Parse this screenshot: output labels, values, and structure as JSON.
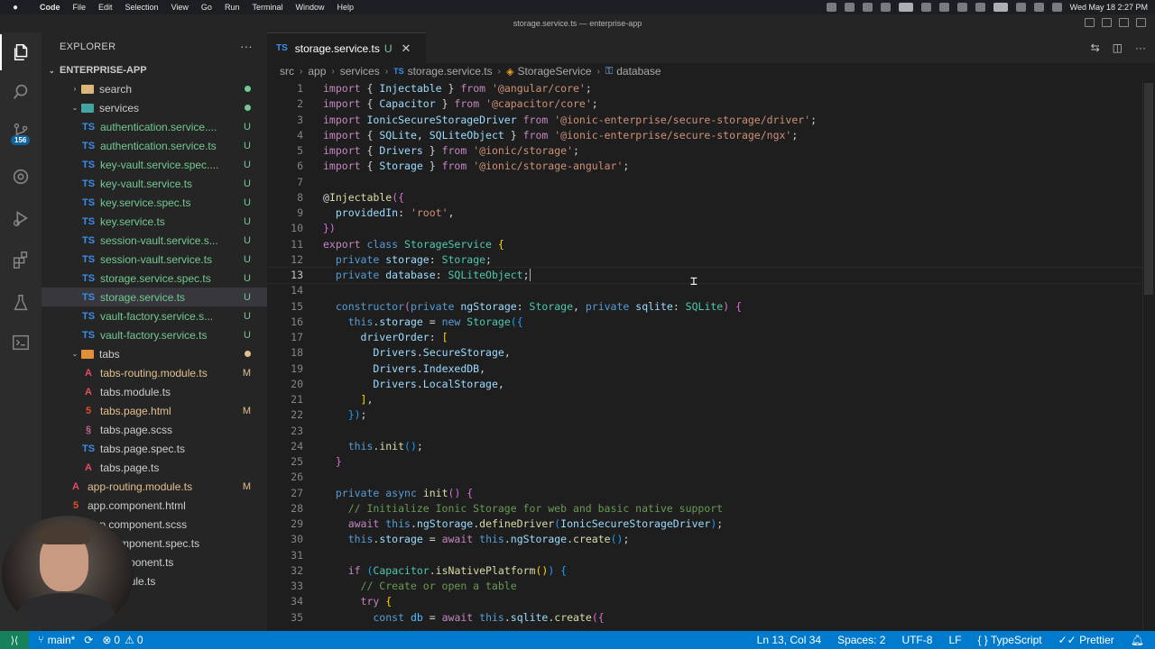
{
  "menubar": {
    "app": "Code",
    "items": [
      "File",
      "Edit",
      "Selection",
      "View",
      "Go",
      "Run",
      "Terminal",
      "Window",
      "Help"
    ],
    "clock": "Wed May 18  2:27 PM"
  },
  "window": {
    "title": "storage.service.ts — enterprise-app"
  },
  "activitybar": {
    "scm_badge": "156"
  },
  "sidebar": {
    "header": "EXPLORER",
    "more": "···",
    "root": "ENTERPRISE-APP",
    "rows": [
      {
        "label": "search",
        "kind": "folder",
        "indent": 1,
        "chev": "›",
        "dot": "#73c991"
      },
      {
        "label": "services",
        "kind": "folder",
        "indent": 1,
        "chev": "⌄",
        "dot": "#73c991"
      },
      {
        "label": "authentication.service....",
        "kind": "ts",
        "indent": 2,
        "status": "U"
      },
      {
        "label": "authentication.service.ts",
        "kind": "ts",
        "indent": 2,
        "status": "U"
      },
      {
        "label": "key-vault.service.spec....",
        "kind": "ts",
        "indent": 2,
        "status": "U"
      },
      {
        "label": "key-vault.service.ts",
        "kind": "ts",
        "indent": 2,
        "status": "U"
      },
      {
        "label": "key.service.spec.ts",
        "kind": "ts",
        "indent": 2,
        "status": "U"
      },
      {
        "label": "key.service.ts",
        "kind": "ts",
        "indent": 2,
        "status": "U"
      },
      {
        "label": "session-vault.service.s...",
        "kind": "ts",
        "indent": 2,
        "status": "U"
      },
      {
        "label": "session-vault.service.ts",
        "kind": "ts",
        "indent": 2,
        "status": "U"
      },
      {
        "label": "storage.service.spec.ts",
        "kind": "ts",
        "indent": 2,
        "status": "U"
      },
      {
        "label": "storage.service.ts",
        "kind": "ts",
        "indent": 2,
        "status": "U",
        "selected": true
      },
      {
        "label": "vault-factory.service.s...",
        "kind": "ts",
        "indent": 2,
        "status": "U"
      },
      {
        "label": "vault-factory.service.ts",
        "kind": "ts",
        "indent": 2,
        "status": "U"
      },
      {
        "label": "tabs",
        "kind": "folder",
        "indent": 1,
        "chev": "⌄",
        "dot": "#e2c08d"
      },
      {
        "label": "tabs-routing.module.ts",
        "kind": "ng",
        "indent": 2,
        "status": "M"
      },
      {
        "label": "tabs.module.ts",
        "kind": "ng",
        "indent": 2
      },
      {
        "label": "tabs.page.html",
        "kind": "html",
        "indent": 2,
        "status": "M"
      },
      {
        "label": "tabs.page.scss",
        "kind": "css",
        "indent": 2
      },
      {
        "label": "tabs.page.spec.ts",
        "kind": "ts",
        "indent": 2
      },
      {
        "label": "tabs.page.ts",
        "kind": "ng",
        "indent": 2
      },
      {
        "label": "app-routing.module.ts",
        "kind": "ng",
        "indent": 1,
        "status": "M"
      },
      {
        "label": "app.component.html",
        "kind": "html",
        "indent": 1
      },
      {
        "label": "app.component.scss",
        "kind": "css",
        "indent": 1
      },
      {
        "label": "app.component.spec.ts",
        "kind": "ts",
        "indent": 1
      },
      {
        "label": "app.component.ts",
        "kind": "ng",
        "indent": 1
      },
      {
        "label": "app.module.ts",
        "kind": "ng",
        "indent": 1
      }
    ]
  },
  "editor": {
    "tab": {
      "icon": "TS",
      "name": "storage.service.ts",
      "status": "U"
    },
    "breadcrumb": [
      "src",
      "app",
      "services",
      "storage.service.ts",
      "StorageService",
      "database"
    ],
    "current_line": 13,
    "lines": [
      [
        [
          "import",
          "#c586c0"
        ],
        [
          " { ",
          "#d4d4d4"
        ],
        [
          "Injectable",
          "#9cdcfe"
        ],
        [
          " } ",
          "#d4d4d4"
        ],
        [
          "from",
          "#c586c0"
        ],
        [
          " ",
          "#d4d4d4"
        ],
        [
          "'@angular/core'",
          "#ce9178"
        ],
        [
          ";",
          "#d4d4d4"
        ]
      ],
      [
        [
          "import",
          "#c586c0"
        ],
        [
          " { ",
          "#d4d4d4"
        ],
        [
          "Capacitor",
          "#9cdcfe"
        ],
        [
          " } ",
          "#d4d4d4"
        ],
        [
          "from",
          "#c586c0"
        ],
        [
          " ",
          "#d4d4d4"
        ],
        [
          "'@capacitor/core'",
          "#ce9178"
        ],
        [
          ";",
          "#d4d4d4"
        ]
      ],
      [
        [
          "import",
          "#c586c0"
        ],
        [
          " ",
          "#d4d4d4"
        ],
        [
          "IonicSecureStorageDriver",
          "#9cdcfe"
        ],
        [
          " ",
          "#d4d4d4"
        ],
        [
          "from",
          "#c586c0"
        ],
        [
          " ",
          "#d4d4d4"
        ],
        [
          "'@ionic-enterprise/secure-storage/driver'",
          "#ce9178"
        ],
        [
          ";",
          "#d4d4d4"
        ]
      ],
      [
        [
          "import",
          "#c586c0"
        ],
        [
          " { ",
          "#d4d4d4"
        ],
        [
          "SQLite",
          "#9cdcfe"
        ],
        [
          ", ",
          "#d4d4d4"
        ],
        [
          "SQLiteObject",
          "#9cdcfe"
        ],
        [
          " } ",
          "#d4d4d4"
        ],
        [
          "from",
          "#c586c0"
        ],
        [
          " ",
          "#d4d4d4"
        ],
        [
          "'@ionic-enterprise/secure-storage/ngx'",
          "#ce9178"
        ],
        [
          ";",
          "#d4d4d4"
        ]
      ],
      [
        [
          "import",
          "#c586c0"
        ],
        [
          " { ",
          "#d4d4d4"
        ],
        [
          "Drivers",
          "#9cdcfe"
        ],
        [
          " } ",
          "#d4d4d4"
        ],
        [
          "from",
          "#c586c0"
        ],
        [
          " ",
          "#d4d4d4"
        ],
        [
          "'@ionic/storage'",
          "#ce9178"
        ],
        [
          ";",
          "#d4d4d4"
        ]
      ],
      [
        [
          "import",
          "#c586c0"
        ],
        [
          " { ",
          "#d4d4d4"
        ],
        [
          "Storage",
          "#9cdcfe"
        ],
        [
          " } ",
          "#d4d4d4"
        ],
        [
          "from",
          "#c586c0"
        ],
        [
          " ",
          "#d4d4d4"
        ],
        [
          "'@ionic/storage-angular'",
          "#ce9178"
        ],
        [
          ";",
          "#d4d4d4"
        ]
      ],
      [],
      [
        [
          "@",
          "#d4d4d4"
        ],
        [
          "Injectable",
          "#dcdcaa"
        ],
        [
          "({",
          "#da70d6"
        ]
      ],
      [
        [
          "  providedIn",
          "#9cdcfe"
        ],
        [
          ": ",
          "#d4d4d4"
        ],
        [
          "'root'",
          "#ce9178"
        ],
        [
          ",",
          "#d4d4d4"
        ]
      ],
      [
        [
          "})",
          "#da70d6"
        ]
      ],
      [
        [
          "export",
          "#c586c0"
        ],
        [
          " ",
          "#d4d4d4"
        ],
        [
          "class",
          "#569cd6"
        ],
        [
          " ",
          "#d4d4d4"
        ],
        [
          "StorageService",
          "#4ec9b0"
        ],
        [
          " {",
          "#ffd700"
        ]
      ],
      [
        [
          "  private",
          "#569cd6"
        ],
        [
          " ",
          "#d4d4d4"
        ],
        [
          "storage",
          "#9cdcfe"
        ],
        [
          ": ",
          "#d4d4d4"
        ],
        [
          "Storage",
          "#4ec9b0"
        ],
        [
          ";",
          "#d4d4d4"
        ]
      ],
      [
        [
          "  private",
          "#569cd6"
        ],
        [
          " ",
          "#d4d4d4"
        ],
        [
          "database",
          "#9cdcfe"
        ],
        [
          ": ",
          "#d4d4d4"
        ],
        [
          "SQLiteObject",
          "#4ec9b0"
        ],
        [
          ";",
          "#d4d4d4"
        ]
      ],
      [],
      [
        [
          "  constructor",
          "#569cd6"
        ],
        [
          "(",
          "#da70d6"
        ],
        [
          "private",
          "#569cd6"
        ],
        [
          " ",
          "#d4d4d4"
        ],
        [
          "ngStorage",
          "#9cdcfe"
        ],
        [
          ": ",
          "#d4d4d4"
        ],
        [
          "Storage",
          "#4ec9b0"
        ],
        [
          ", ",
          "#d4d4d4"
        ],
        [
          "private",
          "#569cd6"
        ],
        [
          " ",
          "#d4d4d4"
        ],
        [
          "sqlite",
          "#9cdcfe"
        ],
        [
          ": ",
          "#d4d4d4"
        ],
        [
          "SQLite",
          "#4ec9b0"
        ],
        [
          ")",
          "#da70d6"
        ],
        [
          " {",
          "#da70d6"
        ]
      ],
      [
        [
          "    this",
          "#569cd6"
        ],
        [
          ".",
          "#d4d4d4"
        ],
        [
          "storage",
          "#9cdcfe"
        ],
        [
          " = ",
          "#d4d4d4"
        ],
        [
          "new",
          "#569cd6"
        ],
        [
          " ",
          "#d4d4d4"
        ],
        [
          "Storage",
          "#4ec9b0"
        ],
        [
          "({",
          "#179fff"
        ]
      ],
      [
        [
          "      driverOrder",
          "#9cdcfe"
        ],
        [
          ": ",
          "#d4d4d4"
        ],
        [
          "[",
          "#ffd700"
        ]
      ],
      [
        [
          "        Drivers",
          "#9cdcfe"
        ],
        [
          ".",
          "#d4d4d4"
        ],
        [
          "SecureStorage",
          "#9cdcfe"
        ],
        [
          ",",
          "#d4d4d4"
        ]
      ],
      [
        [
          "        Drivers",
          "#9cdcfe"
        ],
        [
          ".",
          "#d4d4d4"
        ],
        [
          "IndexedDB",
          "#9cdcfe"
        ],
        [
          ",",
          "#d4d4d4"
        ]
      ],
      [
        [
          "        Drivers",
          "#9cdcfe"
        ],
        [
          ".",
          "#d4d4d4"
        ],
        [
          "LocalStorage",
          "#9cdcfe"
        ],
        [
          ",",
          "#d4d4d4"
        ]
      ],
      [
        [
          "      ]",
          "#ffd700"
        ],
        [
          ",",
          "#d4d4d4"
        ]
      ],
      [
        [
          "    })",
          "#179fff"
        ],
        [
          ";",
          "#d4d4d4"
        ]
      ],
      [],
      [
        [
          "    this",
          "#569cd6"
        ],
        [
          ".",
          "#d4d4d4"
        ],
        [
          "init",
          "#dcdcaa"
        ],
        [
          "()",
          "#179fff"
        ],
        [
          ";",
          "#d4d4d4"
        ]
      ],
      [
        [
          "  }",
          "#da70d6"
        ]
      ],
      [],
      [
        [
          "  private",
          "#569cd6"
        ],
        [
          " ",
          "#d4d4d4"
        ],
        [
          "async",
          "#569cd6"
        ],
        [
          " ",
          "#d4d4d4"
        ],
        [
          "init",
          "#dcdcaa"
        ],
        [
          "()",
          "#da70d6"
        ],
        [
          " {",
          "#da70d6"
        ]
      ],
      [
        [
          "    // Initialize Ionic Storage for web and basic native support",
          "#6a9955"
        ]
      ],
      [
        [
          "    await",
          "#c586c0"
        ],
        [
          " ",
          "#d4d4d4"
        ],
        [
          "this",
          "#569cd6"
        ],
        [
          ".",
          "#d4d4d4"
        ],
        [
          "ngStorage",
          "#9cdcfe"
        ],
        [
          ".",
          "#d4d4d4"
        ],
        [
          "defineDriver",
          "#dcdcaa"
        ],
        [
          "(",
          "#179fff"
        ],
        [
          "IonicSecureStorageDriver",
          "#9cdcfe"
        ],
        [
          ")",
          "#179fff"
        ],
        [
          ";",
          "#d4d4d4"
        ]
      ],
      [
        [
          "    this",
          "#569cd6"
        ],
        [
          ".",
          "#d4d4d4"
        ],
        [
          "storage",
          "#9cdcfe"
        ],
        [
          " = ",
          "#d4d4d4"
        ],
        [
          "await",
          "#c586c0"
        ],
        [
          " ",
          "#d4d4d4"
        ],
        [
          "this",
          "#569cd6"
        ],
        [
          ".",
          "#d4d4d4"
        ],
        [
          "ngStorage",
          "#9cdcfe"
        ],
        [
          ".",
          "#d4d4d4"
        ],
        [
          "create",
          "#dcdcaa"
        ],
        [
          "()",
          "#179fff"
        ],
        [
          ";",
          "#d4d4d4"
        ]
      ],
      [],
      [
        [
          "    if",
          "#c586c0"
        ],
        [
          " ",
          "#d4d4d4"
        ],
        [
          "(",
          "#179fff"
        ],
        [
          "Capacitor",
          "#4ec9b0"
        ],
        [
          ".",
          "#d4d4d4"
        ],
        [
          "isNativePlatform",
          "#dcdcaa"
        ],
        [
          "()",
          "#ffd700"
        ],
        [
          ")",
          "#179fff"
        ],
        [
          " {",
          "#179fff"
        ]
      ],
      [
        [
          "      // Create or open a table",
          "#6a9955"
        ]
      ],
      [
        [
          "      try",
          "#c586c0"
        ],
        [
          " {",
          "#ffd700"
        ]
      ],
      [
        [
          "        const",
          "#569cd6"
        ],
        [
          " ",
          "#d4d4d4"
        ],
        [
          "db",
          "#4fc1ff"
        ],
        [
          " = ",
          "#d4d4d4"
        ],
        [
          "await",
          "#c586c0"
        ],
        [
          " ",
          "#d4d4d4"
        ],
        [
          "this",
          "#569cd6"
        ],
        [
          ".",
          "#d4d4d4"
        ],
        [
          "sqlite",
          "#9cdcfe"
        ],
        [
          ".",
          "#d4d4d4"
        ],
        [
          "create",
          "#dcdcaa"
        ],
        [
          "({",
          "#da70d6"
        ]
      ]
    ]
  },
  "statusbar": {
    "branch": "main*",
    "errors": "0",
    "warnings": "0",
    "position": "Ln 13, Col 34",
    "spaces": "Spaces: 2",
    "encoding": "UTF-8",
    "eol": "LF",
    "language": "TypeScript",
    "formatter": "Prettier"
  }
}
